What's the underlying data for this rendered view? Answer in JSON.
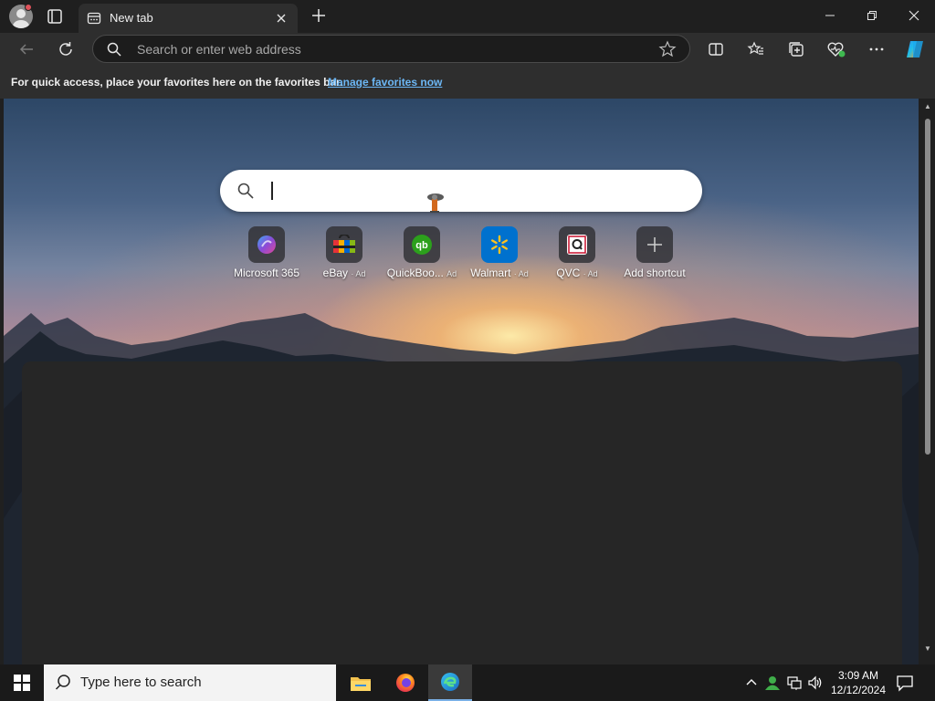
{
  "browser": {
    "tab": {
      "title": "New tab"
    },
    "address_bar": {
      "placeholder": "Search or enter web address"
    },
    "favorites_bar": {
      "message": "For quick access, place your favorites here on the favorites bar.",
      "link": "Manage favorites now"
    }
  },
  "newtab": {
    "search": {
      "placeholder": ""
    },
    "shortcuts": [
      {
        "label": "Microsoft 365",
        "ad": "",
        "icon": "microsoft-365-icon"
      },
      {
        "label": "eBay",
        "ad": "· Ad",
        "icon": "ebay-icon"
      },
      {
        "label": "QuickBoo...",
        "ad": "Ad",
        "icon": "quickbooks-icon"
      },
      {
        "label": "Walmart",
        "ad": "· Ad",
        "icon": "walmart-icon"
      },
      {
        "label": "QVC",
        "ad": "· Ad",
        "icon": "qvc-icon"
      },
      {
        "label": "Add shortcut",
        "ad": "",
        "icon": "plus-icon"
      }
    ]
  },
  "taskbar": {
    "search_placeholder": "Type here to search",
    "clock": {
      "time": "3:09 AM",
      "date": "12/12/2024"
    }
  },
  "colors": {
    "accent": "#6cb7f5",
    "taskbar": "#1a1a1a",
    "tab_active": "#2e2e2e"
  }
}
